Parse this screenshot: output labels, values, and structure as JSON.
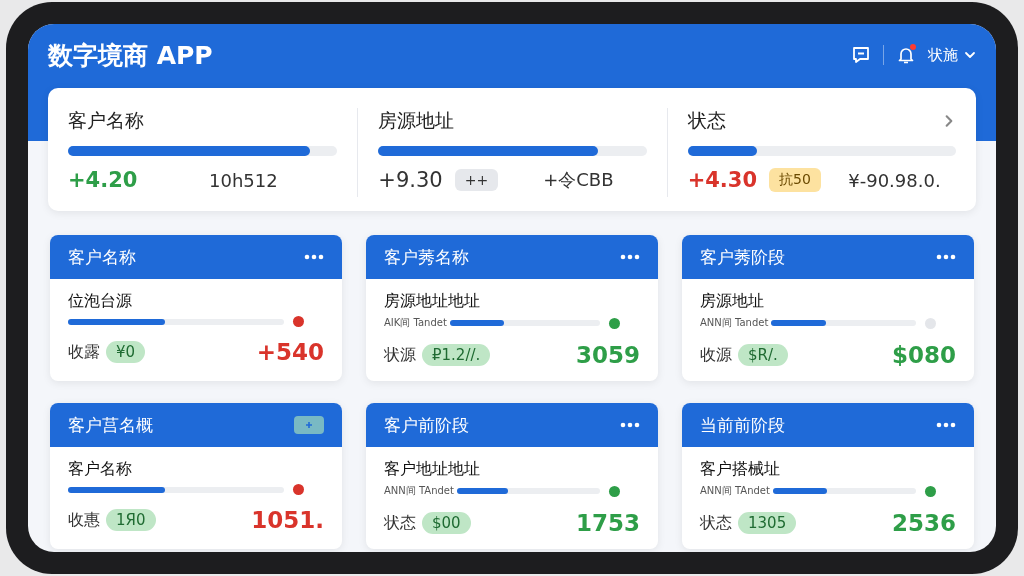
{
  "app_bar": {
    "title": "数字境商 APP",
    "notification_dot": true,
    "user_label": "状施"
  },
  "summary": [
    {
      "label": "客户名称",
      "level": 0.9,
      "value": "+4.20",
      "color": "#2e9e48",
      "note": "10h512",
      "chevron": false
    },
    {
      "label": "房源地址",
      "level": 0.82,
      "value": "+9.30",
      "color": "#333333",
      "badge": {
        "text": "++",
        "kind": "neutral"
      },
      "note": "+令CBB",
      "chevron": false
    },
    {
      "label": "状态",
      "level": 0.26,
      "value": "+4.30",
      "color": "#d9342b",
      "badge": {
        "text": "抗50",
        "kind": "warning"
      },
      "note": "¥-90.98.0.",
      "chevron": true
    }
  ],
  "cards": [
    {
      "title": "客户名称",
      "add_button": false,
      "subtitle": "位泡台源",
      "level": 0.45,
      "color": "#d9342b",
      "label": "收露",
      "badge": "¥0",
      "value": "+540",
      "negative": true
    },
    {
      "title": "客户莠名称",
      "add_button": false,
      "subtitle": "房源地址地址",
      "caption": "AIK间 Tandet",
      "level": 0.36,
      "color": "#2e9e48",
      "label": "状源",
      "badge": "₽1.2//.",
      "value": "3059",
      "negative": false
    },
    {
      "title": "客户莠阶段",
      "add_button": false,
      "subtitle": "房源地址",
      "caption": "ANN间 Tandet",
      "level": 0.38,
      "color": "#e4e6ea",
      "label": "收源",
      "badge": "$R/.",
      "value": "$080",
      "negative": false
    },
    {
      "title": "客户莒名概",
      "add_button": true,
      "subtitle": "客户名称",
      "level": 0.45,
      "color": "#d9342b",
      "label": "收惠",
      "badge": "1Я0",
      "value": "1051.",
      "negative": true
    },
    {
      "title": "客户前阶段",
      "add_button": false,
      "subtitle": "客户地址地址",
      "caption": "ANN间 TAndet",
      "level": 0.36,
      "color": "#2e9e48",
      "label": "状态",
      "badge": "$00",
      "value": "1753",
      "negative": false
    },
    {
      "title": "当前前阶段",
      "add_button": false,
      "subtitle": "客户搭械址",
      "caption": "ANN间 TAndet",
      "level": 0.38,
      "color": "#2e9e48",
      "label": "状态",
      "badge": "1305",
      "value": "2536",
      "negative": false
    }
  ]
}
